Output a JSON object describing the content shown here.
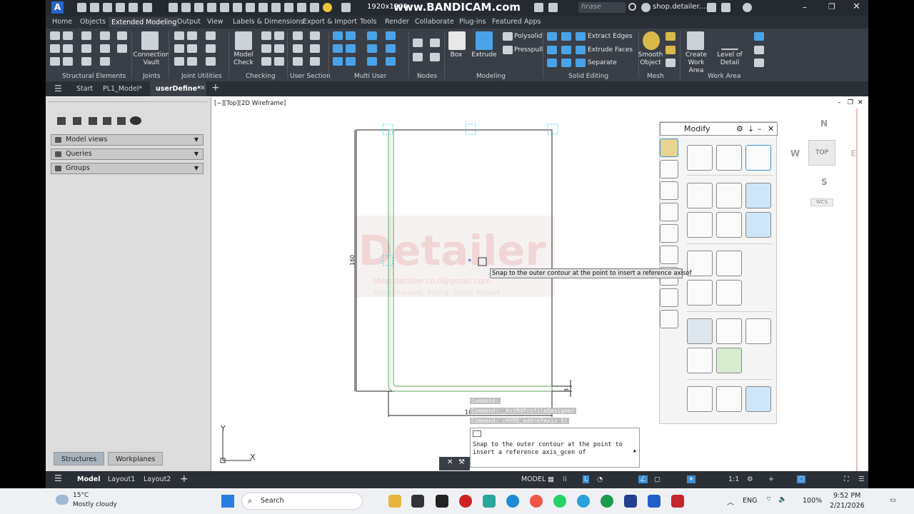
{
  "qat": {
    "resolution": "1920x1200",
    "watermark": "www.BANDICAM.com",
    "search_placeholder": "hrase",
    "user": "shop.detailer...."
  },
  "menu_tabs": [
    "Home",
    "Objects",
    "Extended Modeling",
    "Output",
    "View",
    "Labels & Dimensions",
    "Export & Import",
    "Tools",
    "Render",
    "Collaborate",
    "Plug-ins",
    "Featured Apps"
  ],
  "active_menu": "Extended Modeling",
  "ribbon": {
    "labels": {
      "connection_vault": "Connection\nVault",
      "model_check": "Model\nCheck",
      "box": "Box",
      "extrude": "Extrude",
      "polysolid": "Polysolid",
      "presspull": "Presspull",
      "extract_edges": "Extract Edges",
      "extrude_faces": "Extrude Faces",
      "separate": "Separate",
      "smooth_object": "Smooth\nObject",
      "create_work_area": "Create\nWork Area",
      "level_of_detail": "Level of\nDetail"
    },
    "groups": [
      "Structural Elements",
      "Joints",
      "Joint Utilities",
      "Checking",
      "User Section",
      "Multi User",
      "Nodes",
      "Modeling",
      "Solid Editing",
      "Mesh",
      "Work Area"
    ]
  },
  "doc_tabs": [
    "Start",
    "PL1_Model*",
    "userDefine*"
  ],
  "active_doc": "userDefine*",
  "left_panel": {
    "sections": [
      "Model views",
      "Queries",
      "Groups"
    ],
    "bottom_tabs": [
      "Structures",
      "Workplanes"
    ]
  },
  "viewport": {
    "label": "[−][Top][2D Wireframe]",
    "dim_height": "160",
    "dim_width": "100",
    "dim_thick": "3",
    "logo_text": "Detailer",
    "logo_email": "shop.detailer.co.il@gmail.com",
    "logo_tag": "Shop Drawing, Piping, Static Report"
  },
  "viewcube": {
    "n": "N",
    "s": "S",
    "e": "E",
    "w": "W",
    "top": "TOP",
    "wcs": "WCS"
  },
  "modify_palette": {
    "title": "Modify"
  },
  "tooltip": "Snap to the outer contour at the point to insert a reference axisof",
  "command_history": [
    "Command:",
    "Command: _AstM4ProfileDesigner",
    "Command: (HYPE_addrefaxis 5)"
  ],
  "command_prompt": "Snap to the outer contour at the point to insert a reference axis_gcen of",
  "status": {
    "tabs": [
      "Model",
      "Layout1",
      "Layout2"
    ],
    "model": "MODEL",
    "scale": "1:1"
  },
  "taskbar": {
    "temp": "15°C",
    "weather": "Mostly cloudy",
    "search": "Search",
    "lang": "ENG",
    "battery": "100%",
    "time": "9:52 PM",
    "date": "2/21/2026"
  },
  "colors": {
    "accent": "#3b8fd6",
    "ribbon": "#3a3f47",
    "dark": "#2b2f36",
    "canvas": "#ffffff",
    "profile": "#5aa55a",
    "snap": "#2ee0e8"
  }
}
